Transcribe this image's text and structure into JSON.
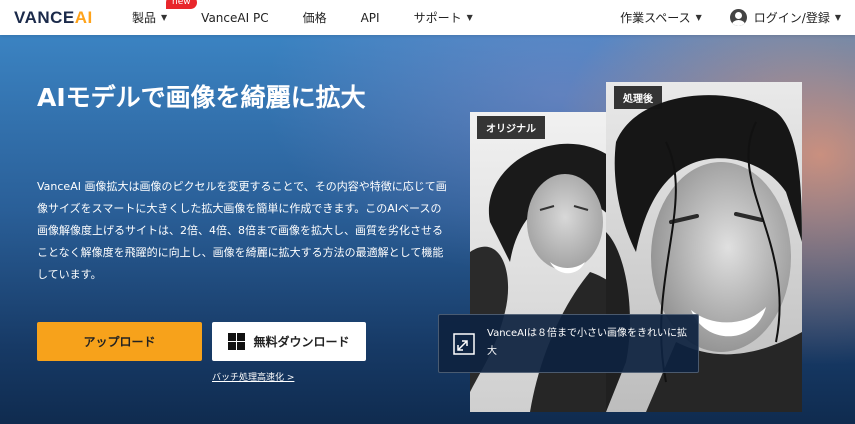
{
  "header": {
    "logo_main": "VANCE",
    "logo_accent": "AI",
    "nav": [
      {
        "label": "製品",
        "has_dropdown": true,
        "badge": "new"
      },
      {
        "label": "VanceAI PC",
        "has_dropdown": false
      },
      {
        "label": "価格",
        "has_dropdown": false
      },
      {
        "label": "API",
        "has_dropdown": false
      },
      {
        "label": "サポート",
        "has_dropdown": true
      }
    ],
    "workspace_label": "作業スペース",
    "login_label": "ログイン/登録"
  },
  "hero": {
    "title": "AIモデルで画像を綺麗に拡大",
    "description": "VanceAI 画像拡大は画像のピクセルを変更することで、その内容や特徴に応じて画像サイズをスマートに大きくした拡大画像を簡単に作成できます。このAIベースの画像解像度上げるサイトは、2倍、4倍、8倍まで画像を拡大し、画質を劣化させることなく解像度を飛躍的に向上し、画像を綺麗に拡大する方法の最適解として機能しています。",
    "upload_button": "アップロード",
    "download_button": "無料ダウンロード",
    "batch_link": "バッチ処理高速化 >"
  },
  "comparison": {
    "before_label": "オリジナル",
    "after_label": "処理後",
    "info_text": "VanceAIは８倍まで小さい画像をきれいに拡大",
    "info_icon": "expand-icon"
  },
  "colors": {
    "accent": "#f7a21b",
    "logo_accent": "#ffa31a",
    "badge": "#e8262b",
    "hero_top": "#3b83c2",
    "hero_bottom": "#0f2b4f"
  }
}
